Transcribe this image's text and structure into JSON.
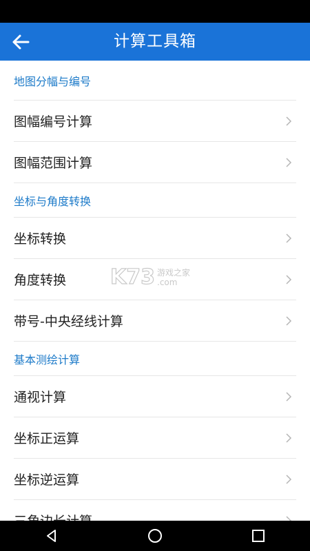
{
  "header": {
    "title": "计算工具箱"
  },
  "sections": [
    {
      "title": "地图分幅与编号",
      "items": [
        "图幅编号计算",
        "图幅范围计算"
      ]
    },
    {
      "title": "坐标与角度转换",
      "items": [
        "坐标转换",
        "角度转换",
        "带号-中央经线计算"
      ]
    },
    {
      "title": "基本测绘计算",
      "items": [
        "通视计算",
        "坐标正运算",
        "坐标逆运算",
        "三角边长计算"
      ]
    }
  ],
  "watermark": {
    "logo": "K73",
    "line1": "游戏之家",
    "line2": ".com"
  },
  "colors": {
    "app_bar": "#1a73d8",
    "section_header": "#1e7bc9"
  }
}
